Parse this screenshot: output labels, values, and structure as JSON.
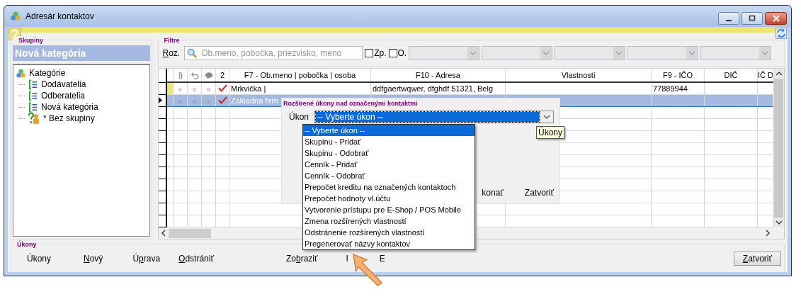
{
  "window": {
    "title": "Adresár kontaktov"
  },
  "groups_panel": {
    "label": "Skupiny",
    "current": "Nová kategória",
    "tree": [
      {
        "label": "Kategórie",
        "kind": "root",
        "children": [
          {
            "label": "Dodávatelia",
            "kind": "category"
          },
          {
            "label": "Odberatelia",
            "kind": "category"
          },
          {
            "label": "Nová kategória",
            "kind": "category"
          },
          {
            "label": "* Bez skupiny",
            "kind": "ungrouped"
          }
        ]
      }
    ]
  },
  "filters": {
    "label": "Filtre",
    "scope_label": {
      "key": "R",
      "after": "oz."
    },
    "search": {
      "placeholder": "Ob.meno, pobočka, priezvisko, meno"
    },
    "checkboxes": [
      {
        "label": "Zp.",
        "checked": false
      },
      {
        "label": "O.",
        "checked": false
      }
    ]
  },
  "table": {
    "columns": [
      {
        "kind": "attachment"
      },
      {
        "kind": "undo"
      },
      {
        "kind": "comment"
      },
      {
        "kind": "text",
        "label": "2"
      },
      {
        "kind": "text",
        "label": "F7 - Ob.meno | pobočka | osoba"
      },
      {
        "kind": "text",
        "label": "F10 - Adresa"
      },
      {
        "kind": "text",
        "label": "Vlastnosti"
      },
      {
        "kind": "text",
        "label": "F9 - IČO"
      },
      {
        "kind": "text",
        "label": "DIČ"
      },
      {
        "kind": "text",
        "label": "IČ D"
      }
    ],
    "rows": [
      {
        "selected": false,
        "flagged": true,
        "checked": true,
        "name": "Mrkvička |",
        "address": "ddfgaertwqwer, dfghdf 51321, Belg",
        "ico": "77889944"
      },
      {
        "selected": true,
        "flagged": false,
        "checked": true,
        "name": "Zakladna firm"
      }
    ]
  },
  "dialog": {
    "title": "Rozšírené úkony nad označenými kontaktmi",
    "field_label": "Úkon",
    "select": {
      "value": "-- Vyberte úkon --",
      "expanded": true,
      "options": [
        {
          "label": "-- Vyberte úkon --",
          "selected": true
        },
        {
          "label": "Skupinu - Pridať",
          "selected": false
        },
        {
          "label": "Skupinu - Odobrať",
          "selected": false
        },
        {
          "label": "Cenník - Pridať",
          "selected": false
        },
        {
          "label": "Cenník - Odobrať",
          "selected": false
        },
        {
          "label": "Prepočet kreditu na označených kontaktoch",
          "selected": false
        },
        {
          "label": "Prepočet hodnoty vl.účtu",
          "selected": false
        },
        {
          "label": "Vytvorenie prístupu pre E-Shop / POS Mobile",
          "selected": false
        },
        {
          "label": "Zmena rozšírených vlastností",
          "selected": false
        },
        {
          "label": "Odstránenie rozšírených vlastností",
          "selected": false
        },
        {
          "label": "Pregenerovať názvy kontaktov",
          "selected": false
        }
      ]
    },
    "buttons": [
      "konať",
      "Zatvoriť"
    ],
    "tooltip": "Úkony"
  },
  "actions_bar": {
    "label": "Úkony",
    "buttons": [
      {
        "before": "Úkony"
      },
      {
        "key": "N",
        "after": "ový"
      },
      {
        "before": "Ú",
        "key": "p",
        "after": "rava"
      },
      {
        "key": "O",
        "after": "dstrániť"
      },
      {
        "before": "Zo",
        "key": "b",
        "after": "raziť"
      },
      {
        "before": "I"
      },
      {
        "before": "E"
      }
    ],
    "close_button": {
      "key": "Z",
      "after": "atvoriť"
    }
  }
}
